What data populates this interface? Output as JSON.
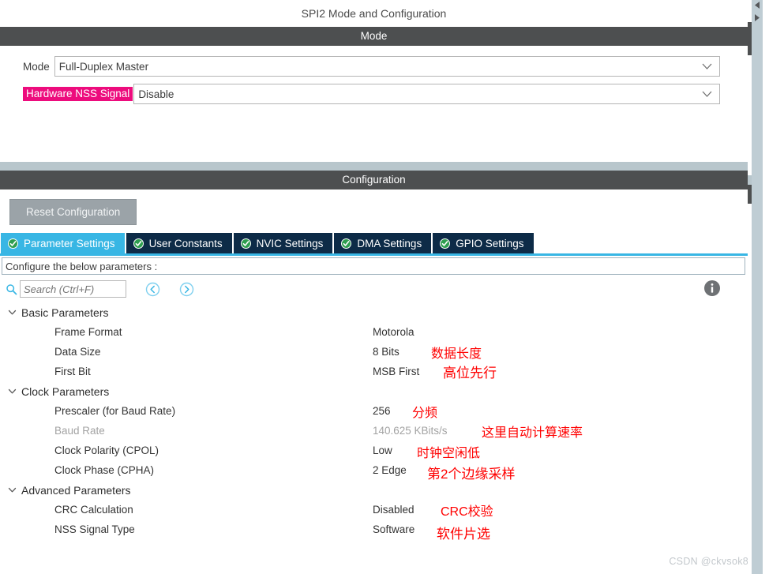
{
  "page": {
    "title": "SPI2 Mode and Configuration",
    "watermark": "CSDN @ckvsok8"
  },
  "colors": {
    "section_bar": "#4d4f50",
    "highlight_pink": "#ed0c7d",
    "accent_blue": "#38b6e4",
    "tab_dark": "#0d2b47",
    "note_red": "#ff0000",
    "strip": "#b8c6cc"
  },
  "mode_section": {
    "header": "Mode",
    "fields": [
      {
        "label": "Mode",
        "value": "Full-Duplex Master",
        "highlighted": false
      },
      {
        "label": "Hardware NSS Signal",
        "value": "Disable",
        "highlighted": true
      }
    ]
  },
  "configuration_section": {
    "header": "Configuration",
    "reset_button": "Reset Configuration",
    "tabs": [
      {
        "label": "Parameter Settings",
        "icon": "green-check-icon",
        "active": true
      },
      {
        "label": "User Constants",
        "icon": "green-check-icon",
        "active": false
      },
      {
        "label": "NVIC Settings",
        "icon": "green-check-icon",
        "active": false
      },
      {
        "label": "DMA Settings",
        "icon": "green-check-icon",
        "active": false
      },
      {
        "label": "GPIO Settings",
        "icon": "green-check-icon",
        "active": false
      }
    ],
    "configure_hint": "Configure the below parameters :",
    "search": {
      "placeholder": "Search (Ctrl+F)",
      "value": "",
      "icon": "search-icon",
      "prev_icon": "nav-prev-icon",
      "next_icon": "nav-next-icon",
      "info_icon": "info-icon"
    },
    "groups": [
      {
        "name": "Basic Parameters",
        "expanded": true,
        "params": [
          {
            "name": "Frame Format",
            "value": "Motorola",
            "dim": false,
            "note": ""
          },
          {
            "name": "Data Size",
            "value": "8 Bits",
            "dim": false,
            "note": "数据长度"
          },
          {
            "name": "First Bit",
            "value": "MSB First",
            "dim": false,
            "note": "高位先行"
          }
        ]
      },
      {
        "name": "Clock Parameters",
        "expanded": true,
        "params": [
          {
            "name": "Prescaler (for Baud Rate)",
            "value": "256",
            "dim": false,
            "note": "分频"
          },
          {
            "name": "Baud Rate",
            "value": "140.625 KBits/s",
            "dim": true,
            "note": "这里自动计算速率"
          },
          {
            "name": "Clock Polarity (CPOL)",
            "value": "Low",
            "dim": false,
            "note": "时钟空闲低"
          },
          {
            "name": "Clock Phase (CPHA)",
            "value": "2 Edge",
            "dim": false,
            "note": "第2个边缘采样"
          }
        ]
      },
      {
        "name": "Advanced Parameters",
        "expanded": true,
        "params": [
          {
            "name": "CRC Calculation",
            "value": "Disabled",
            "dim": false,
            "note": "CRC校验"
          },
          {
            "name": "NSS Signal Type",
            "value": "Software",
            "dim": false,
            "note": "软件片选"
          }
        ]
      }
    ]
  }
}
